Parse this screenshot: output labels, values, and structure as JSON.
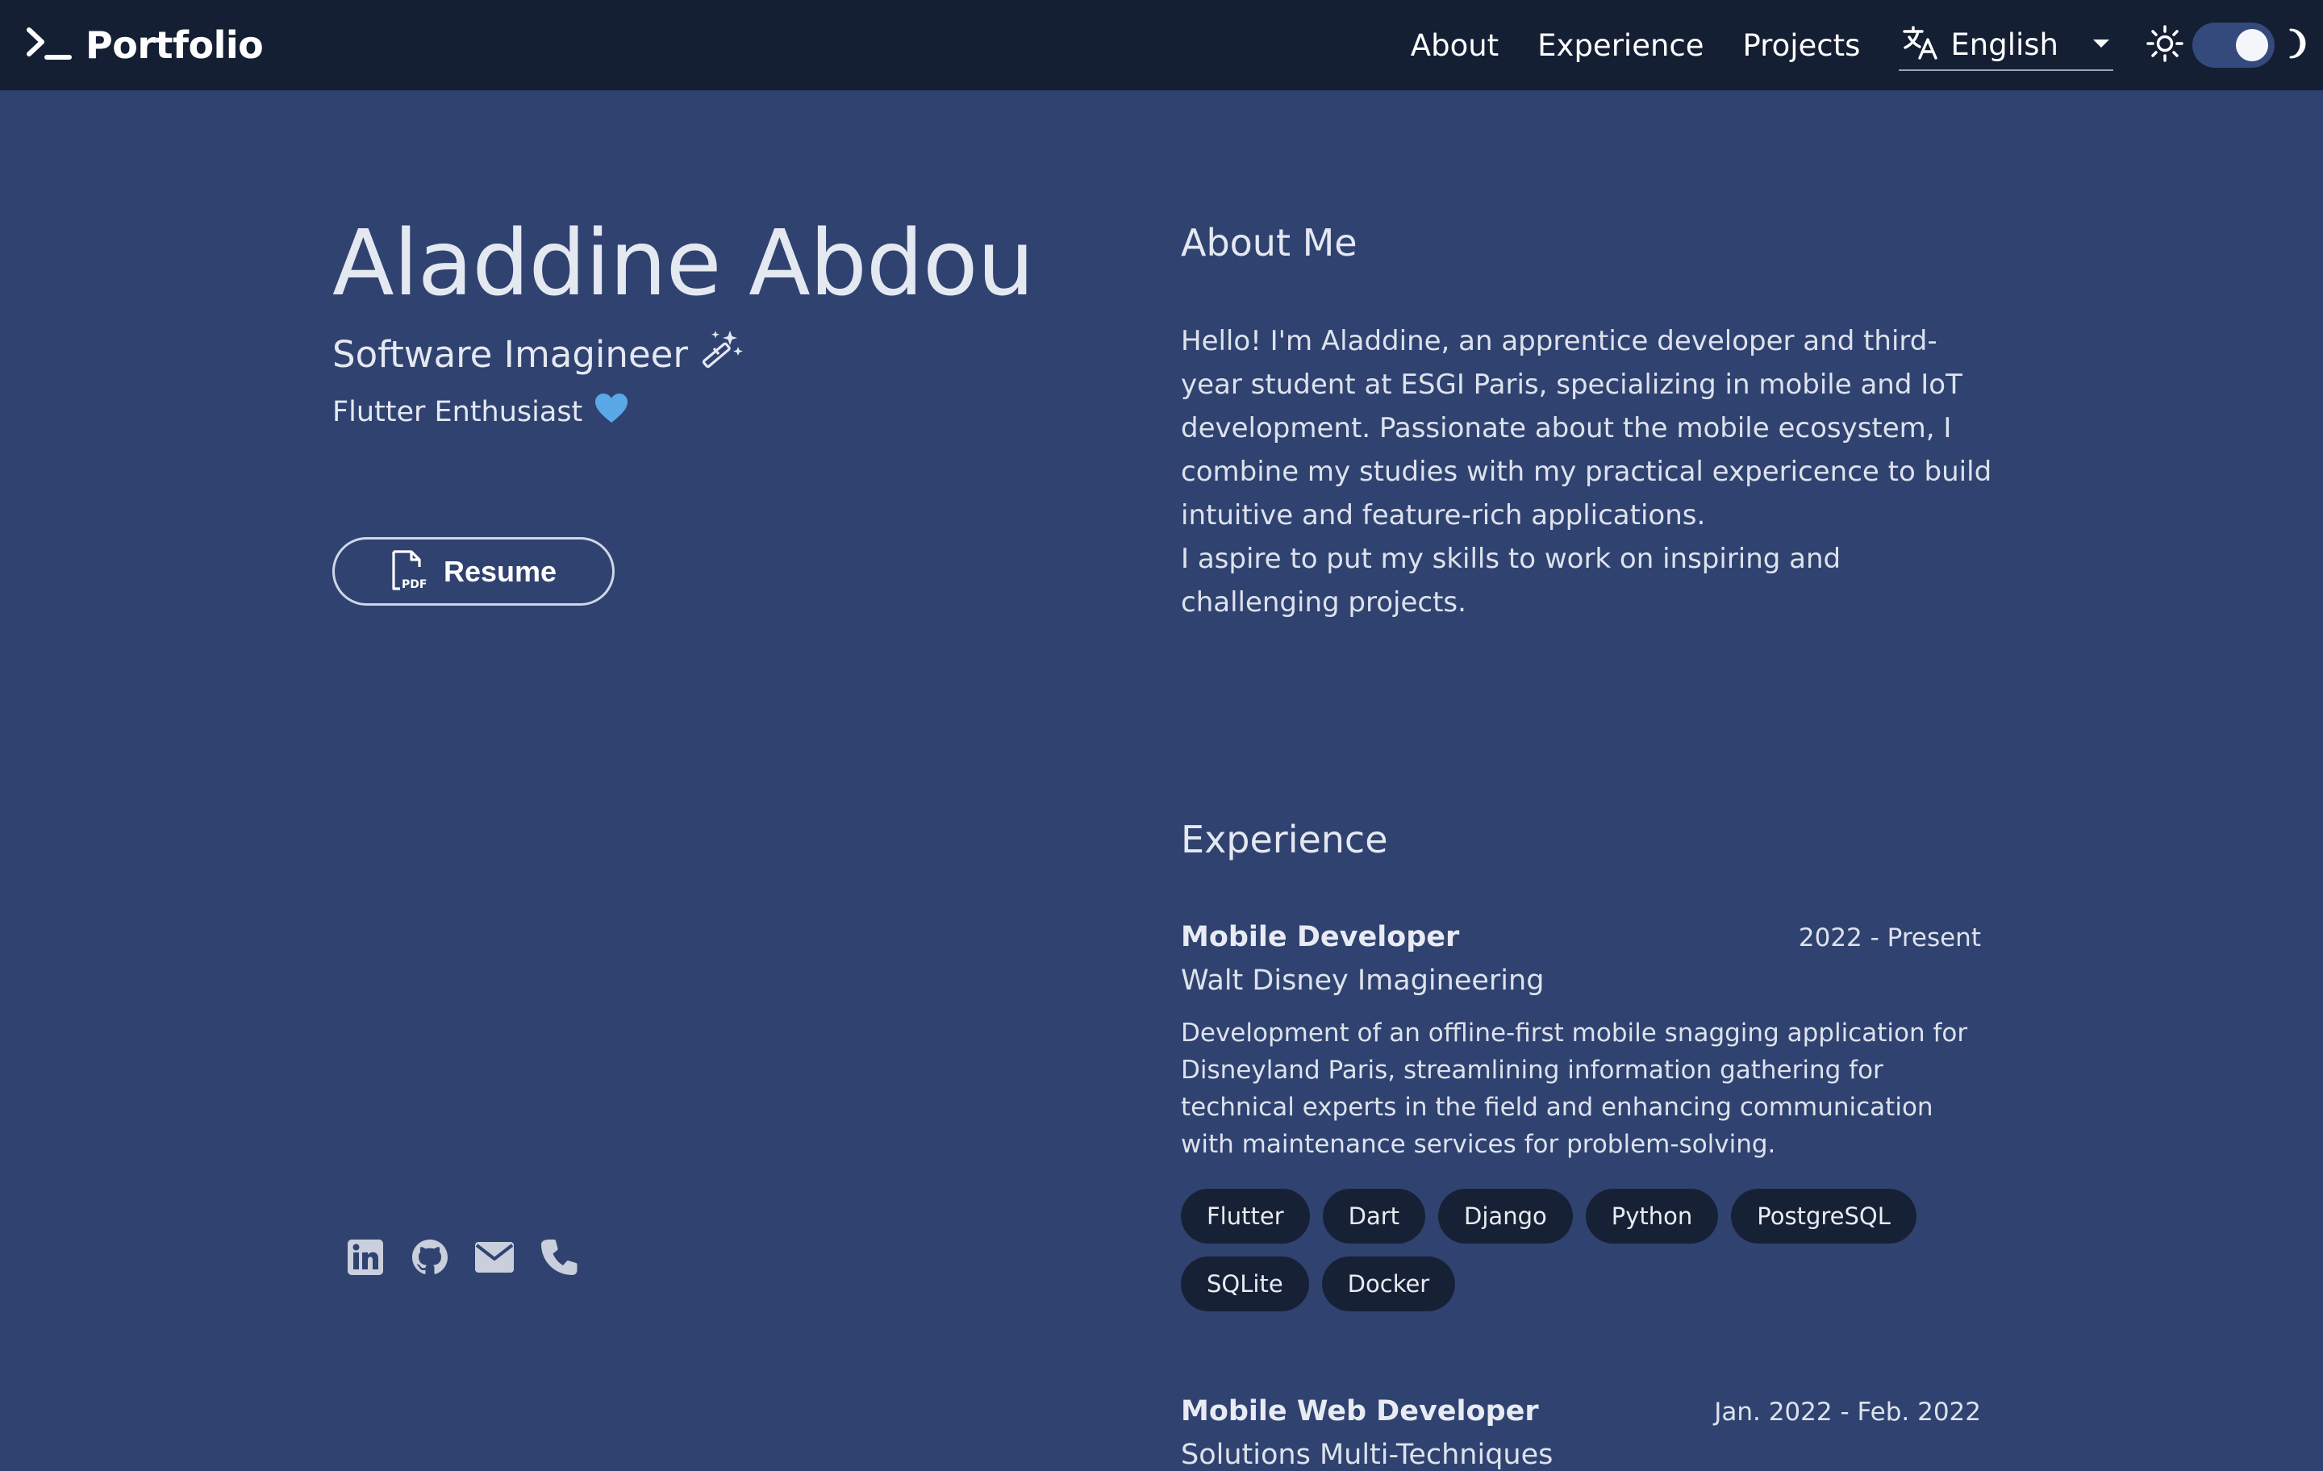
{
  "header": {
    "brand": "Portfolio",
    "brand_icon": "terminal-prompt-icon",
    "nav": [
      "About",
      "Experience",
      "Projects"
    ],
    "language": {
      "icon": "translate-icon",
      "selected": "English"
    },
    "theme": {
      "light_icon": "sun-icon",
      "dark_icon": "moon-icon",
      "dark_mode": true
    }
  },
  "hero": {
    "name": "Aladdine Abdou",
    "title": "Software Imagineer",
    "title_icon": "magic-wand-icon",
    "subtitle": "Flutter Enthusiast",
    "subtitle_icon": "heart-icon",
    "resume_label": "Resume",
    "resume_icon": "pdf-file-icon",
    "socials": [
      "linkedin-icon",
      "github-icon",
      "mail-icon",
      "phone-icon"
    ]
  },
  "about": {
    "heading": "About Me",
    "paragraphs": [
      "Hello! I'm Aladdine, an apprentice developer and third-year student at ESGI Paris, specializing in mobile and IoT development. Passionate about the mobile ecosystem, I combine my studies with my practical expericence to build intuitive and feature-rich applications.",
      "I aspire to put my skills to work on inspiring and challenging projects."
    ]
  },
  "experience": {
    "heading": "Experience",
    "items": [
      {
        "role": "Mobile Developer",
        "dates": "2022 - Present",
        "company": "Walt Disney Imagineering",
        "description": "Development of an offline-first mobile snagging application for Disneyland Paris, streamlining information gathering for technical experts in the field and enhancing communication with maintenance services for problem-solving.",
        "tags": [
          "Flutter",
          "Dart",
          "Django",
          "Python",
          "PostgreSQL",
          "SQLite",
          "Docker"
        ]
      },
      {
        "role": "Mobile Web Developer",
        "dates": "Jan. 2022 - Feb. 2022",
        "company": "Solutions Multi-Techniques"
      }
    ]
  },
  "colors": {
    "page_bg": "#304270",
    "header_bg": "#151f33",
    "chip_bg": "#172136",
    "heart": "#5aa9e6"
  }
}
